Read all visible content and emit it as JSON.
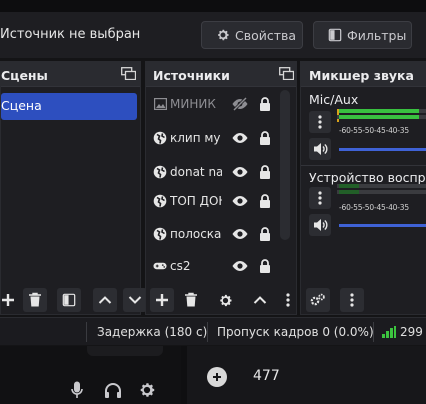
{
  "source_toolbar": {
    "status": "Источник не выбран",
    "properties_label": "Свойства",
    "filters_label": "Фильтры"
  },
  "scenes": {
    "title": "Сцены",
    "items": [
      {
        "label": "Сцена",
        "selected": true
      }
    ]
  },
  "sources": {
    "title": "Источники",
    "items": [
      {
        "label": "МИНИК",
        "icon": "image-icon",
        "visible": false,
        "locked": true
      },
      {
        "label": "клип му",
        "icon": "browser-icon",
        "visible": true,
        "locked": true
      },
      {
        "label": "donat na",
        "icon": "browser-icon",
        "visible": true,
        "locked": true
      },
      {
        "label": "ТОП ДОН",
        "icon": "browser-icon",
        "visible": true,
        "locked": true
      },
      {
        "label": "полоска",
        "icon": "browser-icon",
        "visible": true,
        "locked": true
      },
      {
        "label": "cs2",
        "icon": "gamepad-icon",
        "visible": true,
        "locked": true
      }
    ]
  },
  "mixer": {
    "title": "Микшер звука",
    "channels": [
      {
        "name": "Mic/Aux",
        "scale": "-60-55-50-45-40-35"
      },
      {
        "name": "Устройство воспро",
        "scale": "-60-55-50-45-40-35"
      }
    ]
  },
  "statusbar": {
    "delay": "Задержка (180 с)",
    "dropped": "Пропуск кадров 0 (0.0%)",
    "bitrate": "299"
  },
  "bottom": {
    "count": "477"
  },
  "colors": {
    "accent": "#2d4fbf",
    "meter_green": "#39c140",
    "volume_blue": "#3f62d6"
  }
}
